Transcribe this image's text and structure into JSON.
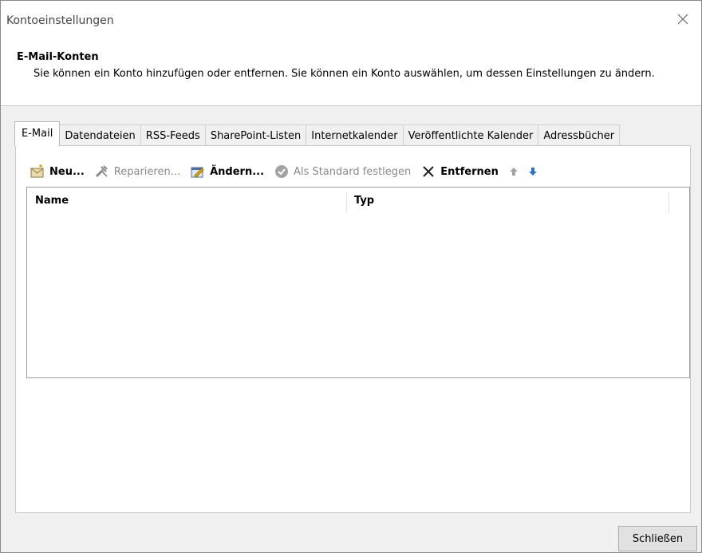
{
  "window": {
    "title": "Kontoeinstellungen"
  },
  "header": {
    "title": "E-Mail-Konten",
    "description": "Sie können ein Konto hinzufügen oder entfernen. Sie können ein Konto auswählen, um dessen Einstellungen zu ändern."
  },
  "tabs": [
    {
      "label": "E-Mail",
      "active": true
    },
    {
      "label": "Datendateien"
    },
    {
      "label": "RSS-Feeds"
    },
    {
      "label": "SharePoint-Listen"
    },
    {
      "label": "Internetkalender"
    },
    {
      "label": "Veröffentlichte Kalender"
    },
    {
      "label": "Adressbücher"
    }
  ],
  "toolbar": {
    "new_label": "Neu...",
    "repair_label": "Reparieren...",
    "change_label": "Ändern...",
    "set_default_label": "Als Standard festlegen",
    "remove_label": "Entfernen",
    "icons": [
      "new-mail-icon",
      "repair-tools-icon",
      "change-settings-icon",
      "check-circle-icon",
      "close-x-icon",
      "arrow-up-icon",
      "arrow-down-icon"
    ]
  },
  "list": {
    "columns": [
      "Name",
      "Typ"
    ],
    "rows": []
  },
  "footer": {
    "close_label": "Schließen"
  },
  "colors": {
    "accent": "#2f6fd1",
    "disabled": "#8a8a8a",
    "background": "#f0f0f0"
  }
}
